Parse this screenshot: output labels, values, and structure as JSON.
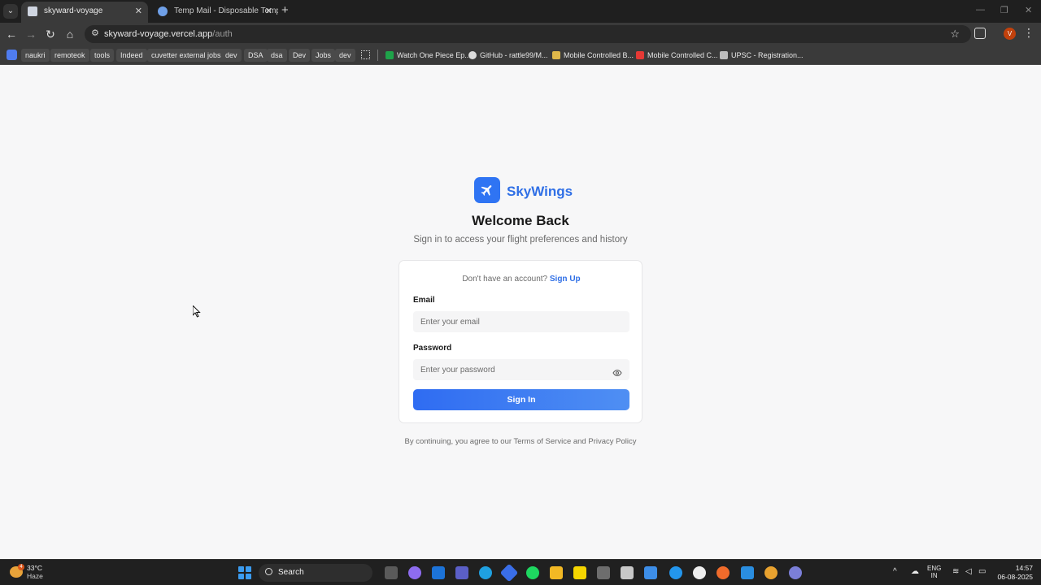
{
  "browser": {
    "tabs": [
      {
        "title": "skyward-voyage",
        "active": true
      },
      {
        "title": "Temp Mail - Disposable Tempo",
        "active": false
      }
    ],
    "url": {
      "host": "skyward-voyage.vercel.app",
      "path": "/auth"
    },
    "profile_initial": "V",
    "bookmarks": [
      "naukri",
      "remoteok",
      "tools",
      "Indeed",
      "cuvetter external jobs",
      "dev",
      "DSA",
      "dsa",
      "Dev",
      "Jobs",
      "dev"
    ],
    "bookmark_links": [
      "Watch One Piece Ep...",
      "GitHub - rattle99/M...",
      "Mobile Controlled B...",
      "Mobile Controlled C...",
      "UPSC - Registration..."
    ]
  },
  "auth": {
    "brand": "SkyWings",
    "heading": "Welcome Back",
    "subtitle": "Sign in to access your flight preferences and history",
    "no_account_text": "Don't have an account?",
    "signup_link": "Sign Up",
    "email_label": "Email",
    "email_placeholder": "Enter your email",
    "password_label": "Password",
    "password_placeholder": "Enter your password",
    "signin_button": "Sign In",
    "terms_text": "By continuing, you agree to our Terms of Service and Privacy Policy",
    "accent_color": "#2f6fe6"
  },
  "taskbar": {
    "weather_temp": "33°C",
    "weather_cond": "Haze",
    "weather_badge": "4",
    "search_label": "Search",
    "lang_top": "ENG",
    "lang_bottom": "IN",
    "time": "14:57",
    "date": "06-08-2025"
  }
}
